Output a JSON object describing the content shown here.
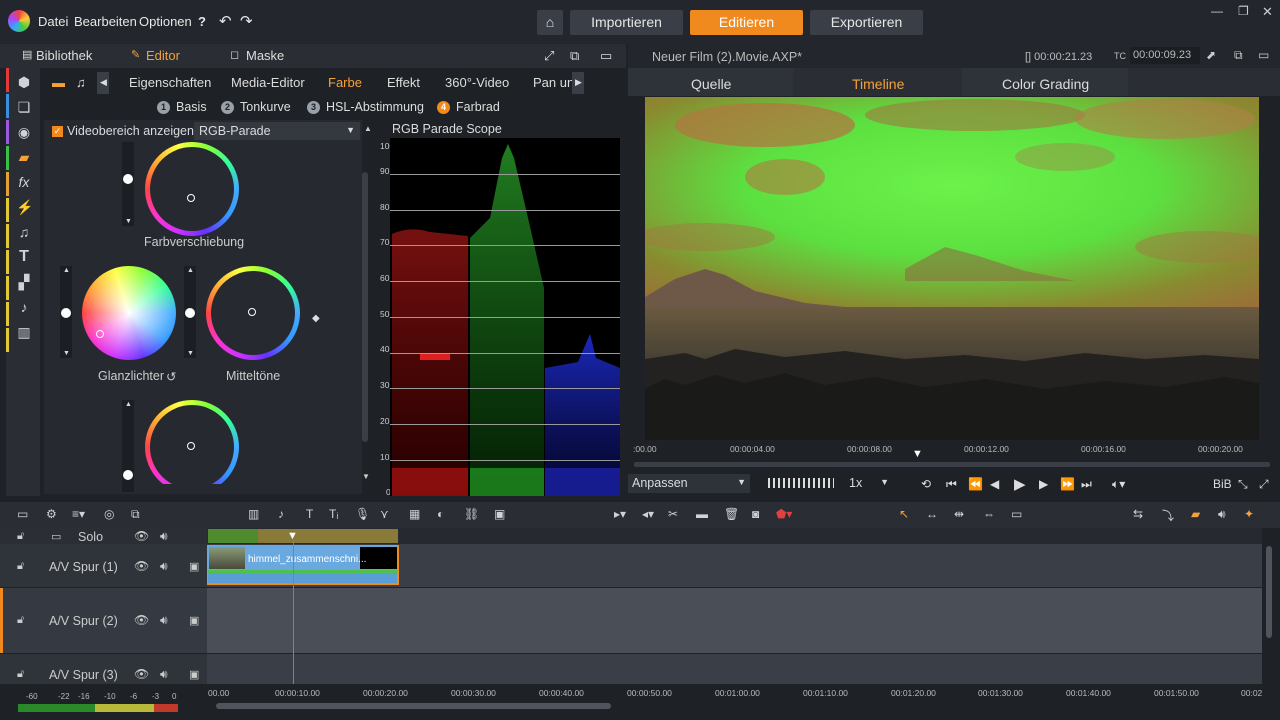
{
  "menu": {
    "datei": "Datei",
    "bearbeiten": "Bearbeiten",
    "optionen": "Optionen"
  },
  "nav": {
    "importieren": "Importieren",
    "editieren": "Editieren",
    "exportieren": "Exportieren"
  },
  "left_tabs": {
    "bibliothek": "Bibliothek",
    "editor": "Editor",
    "maske": "Maske"
  },
  "editor_tabs": [
    "Eigenschaften",
    "Media-Editor",
    "Farbe",
    "Effekt",
    "360°-Video",
    "Pan un"
  ],
  "sub_tabs": [
    {
      "num": "1",
      "label": "Basis"
    },
    {
      "num": "2",
      "label": "Tonkurve"
    },
    {
      "num": "3",
      "label": "HSL-Abstimmung"
    },
    {
      "num": "4",
      "label": "Farbrad"
    }
  ],
  "videobereich": {
    "label": "Videobereich anzeigen",
    "select": "RGB-Parade"
  },
  "wheels": {
    "farbverschiebung": "Farbverschiebung",
    "glanzlichter": "Glanzlichter",
    "mitteltoene": "Mitteltöne"
  },
  "scope": {
    "title": "RGB Parade Scope",
    "ticks": [
      "100",
      "90",
      "80",
      "70",
      "60",
      "50",
      "40",
      "30",
      "20",
      "10",
      "0"
    ]
  },
  "preview": {
    "title": "Neuer Film (2).Movie.AXP*",
    "duration": "[] 00:00:21.23",
    "tc_label": "TC",
    "tc": "00:00:09.23",
    "tabs": [
      "Quelle",
      "Timeline",
      "Color Grading"
    ],
    "ruler": [
      ":00.00",
      "00:00:04.00",
      "00:00:08.00",
      "00:00:12.00",
      "00:00:16.00",
      "00:00:20.00"
    ],
    "fit": "Anpassen",
    "speed": "1x",
    "bib": "BiB"
  },
  "tracks": [
    {
      "name": "Solo"
    },
    {
      "name": "A/V Spur (1)"
    },
    {
      "name": "A/V Spur (2)"
    },
    {
      "name": "A/V Spur (3)"
    }
  ],
  "clip": {
    "label": "himmel_zusammenschni..."
  },
  "tl_ruler": [
    "00.00",
    "00:00:10.00",
    "00:00:20.00",
    "00:00:30.00",
    "00:00:40.00",
    "00:00:50.00",
    "00:01:00.00",
    "00:01:10.00",
    "00:01:20.00",
    "00:01:30.00",
    "00:01:40.00",
    "00:01:50.00",
    "00:02"
  ],
  "meter_ticks": [
    "-60",
    "-22",
    "-16",
    "-10",
    "-6",
    "-3",
    "0"
  ],
  "colors": {
    "accent": "#f08a1e",
    "bg": "#1e2126",
    "panel": "#2a2e34"
  }
}
